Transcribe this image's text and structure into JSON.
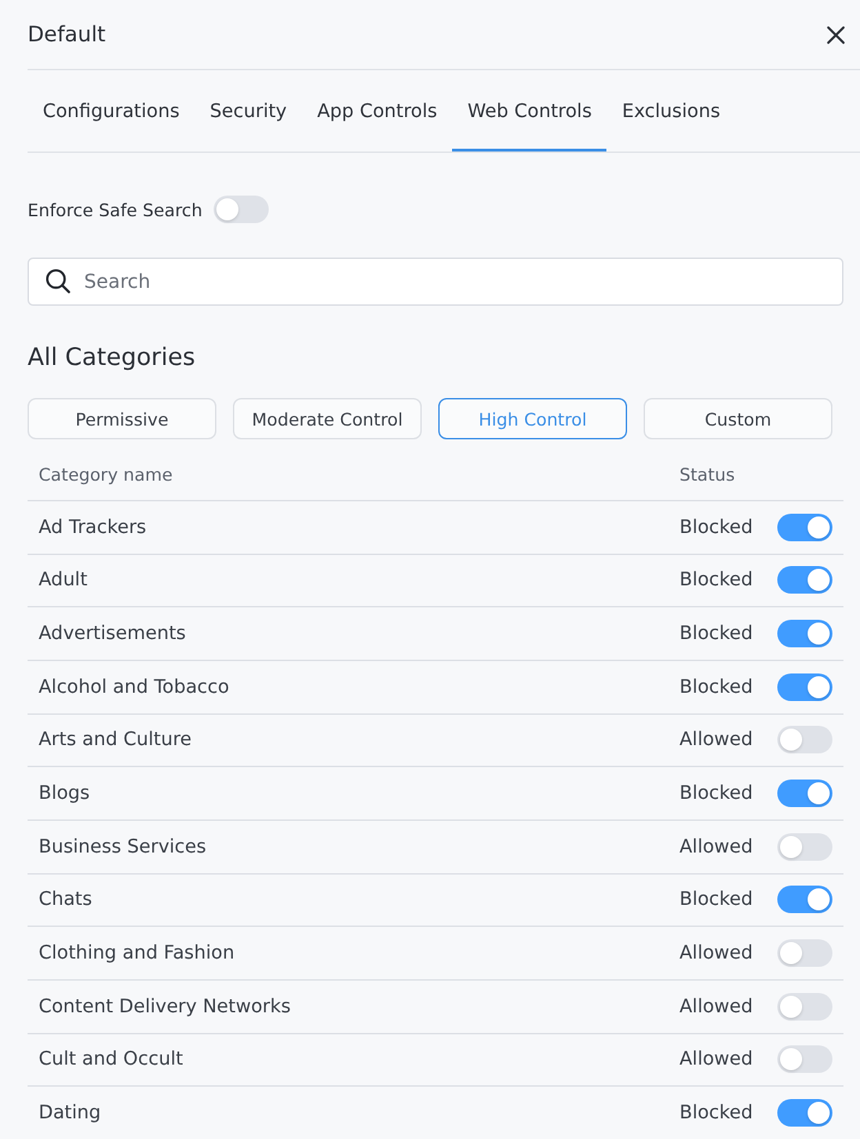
{
  "header": {
    "title": "Default"
  },
  "tabs": [
    {
      "label": "Configurations",
      "selected": false
    },
    {
      "label": "Security",
      "selected": false
    },
    {
      "label": "App Controls",
      "selected": false
    },
    {
      "label": "Web Controls",
      "selected": true
    },
    {
      "label": "Exclusions",
      "selected": false
    }
  ],
  "safe_search": {
    "label": "Enforce Safe Search",
    "on": false
  },
  "search": {
    "placeholder": "Search"
  },
  "section_title": "All Categories",
  "presets": [
    {
      "label": "Permissive",
      "selected": false
    },
    {
      "label": "Moderate Control",
      "selected": false
    },
    {
      "label": "High Control",
      "selected": true
    },
    {
      "label": "Custom",
      "selected": false
    }
  ],
  "table": {
    "columns": [
      "Category name",
      "Status"
    ],
    "rows": [
      {
        "name": "Ad Trackers",
        "status": "Blocked",
        "on": true
      },
      {
        "name": "Adult",
        "status": "Blocked",
        "on": true
      },
      {
        "name": "Advertisements",
        "status": "Blocked",
        "on": true
      },
      {
        "name": "Alcohol and Tobacco",
        "status": "Blocked",
        "on": true
      },
      {
        "name": "Arts and Culture",
        "status": "Allowed",
        "on": false
      },
      {
        "name": "Blogs",
        "status": "Blocked",
        "on": true
      },
      {
        "name": "Business Services",
        "status": "Allowed",
        "on": false
      },
      {
        "name": "Chats",
        "status": "Blocked",
        "on": true
      },
      {
        "name": "Clothing and Fashion",
        "status": "Allowed",
        "on": false
      },
      {
        "name": "Content Delivery Networks",
        "status": "Allowed",
        "on": false
      },
      {
        "name": "Cult and Occult",
        "status": "Allowed",
        "on": false
      },
      {
        "name": "Dating",
        "status": "Blocked",
        "on": true
      }
    ]
  }
}
